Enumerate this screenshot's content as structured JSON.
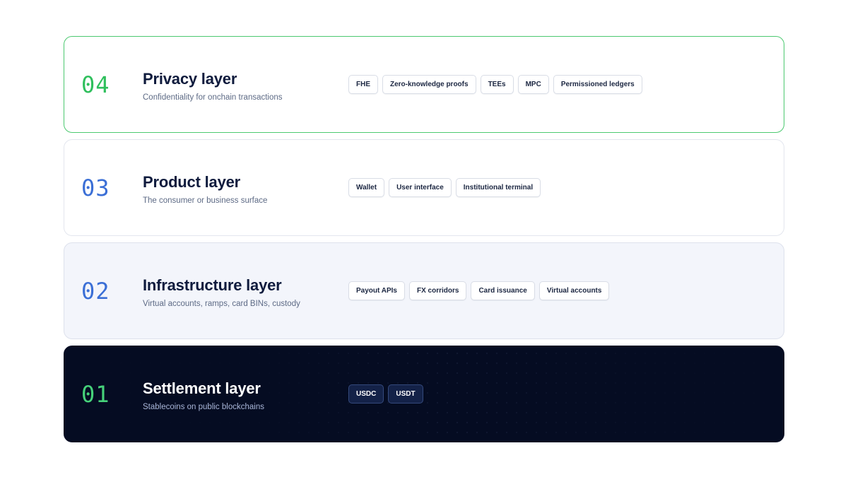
{
  "layers": [
    {
      "number": "04",
      "title": "Privacy layer",
      "subtitle": "Confidentiality for onchain transactions",
      "tags": [
        "FHE",
        "Zero-knowledge proofs",
        "TEEs",
        "MPC",
        "Permissioned ledgers"
      ]
    },
    {
      "number": "03",
      "title": "Product layer",
      "subtitle": "The consumer or business surface",
      "tags": [
        "Wallet",
        "User interface",
        "Institutional terminal"
      ]
    },
    {
      "number": "02",
      "title": "Infrastructure layer",
      "subtitle": "Virtual accounts, ramps, card BINs, custody",
      "tags": [
        "Payout APIs",
        "FX corridors",
        "Card issuance",
        "Virtual accounts"
      ]
    },
    {
      "number": "01",
      "title": "Settlement layer",
      "subtitle": "Stablecoins on public blockchains",
      "tags": [
        "USDC",
        "USDT"
      ]
    }
  ],
  "colors": {
    "privacy_accent": "#2fbf5c",
    "privacy_border": "#4cc970",
    "mid_accent": "#3b6fd6",
    "settlement_bg": "#050c22",
    "settlement_accent": "#46d27a",
    "title_text": "#0f1b3d"
  }
}
